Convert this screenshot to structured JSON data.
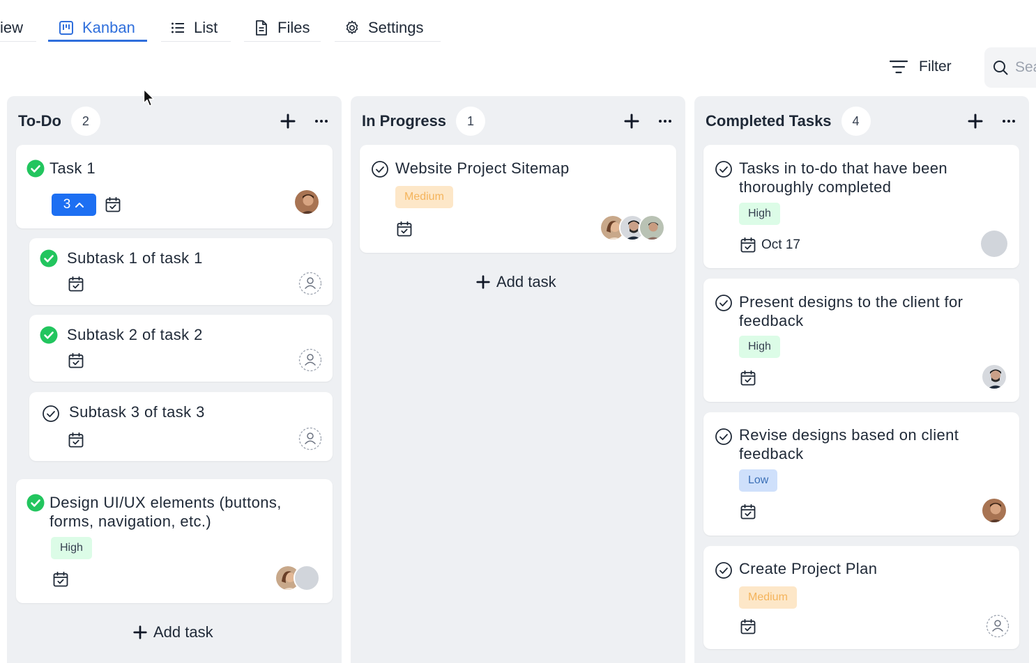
{
  "tabs": [
    {
      "label": "iew",
      "icon": "overview-icon"
    },
    {
      "label": "Kanban",
      "icon": "kanban-icon",
      "active": true
    },
    {
      "label": "List",
      "icon": "list-icon"
    },
    {
      "label": "Files",
      "icon": "file-icon"
    },
    {
      "label": "Settings",
      "icon": "gear-icon"
    }
  ],
  "toolbar": {
    "filter_label": "Filter",
    "search_placeholder": "Search"
  },
  "colors": {
    "accent": "#2f6fdc",
    "done_green": "#22c55e",
    "subtask_blue": "#1d6ff2",
    "column_bg": "#eef0f3"
  },
  "columns": [
    {
      "title": "To-Do",
      "count": "2",
      "add_task_label": "Add task",
      "cards": [
        {
          "title": "Task 1",
          "done": true,
          "subtask_count": "3",
          "assignee": "avatar"
        },
        {
          "title": "Subtask 1 of task 1",
          "done": true,
          "assignee": "unassigned-user-icon"
        },
        {
          "title": "Subtask 2 of task 2",
          "done": true,
          "assignee": "unassigned-user-icon"
        },
        {
          "title": "Subtask 3 of task 3",
          "done": false,
          "assignee": "unassigned-user-icon"
        },
        {
          "title": "Design UI/UX elements (buttons, forms, navigation, etc.)",
          "done": true,
          "priority": "High",
          "assignee": "avatar-group"
        }
      ]
    },
    {
      "title": "In Progress",
      "count": "1",
      "add_task_label": "Add task",
      "cards": [
        {
          "title": "Website Project Sitemap",
          "done": false,
          "priority": "Medium",
          "assignee": "avatar-group"
        }
      ]
    },
    {
      "title": "Completed Tasks",
      "count": "4",
      "cards": [
        {
          "title": "Tasks in to-do that have been thoroughly completed",
          "done": false,
          "priority": "High",
          "due": "Oct 17",
          "assignee": "avatar"
        },
        {
          "title": "Present designs to the client for feedback",
          "done": false,
          "priority": "High",
          "assignee": "avatar"
        },
        {
          "title": "Revise designs based on client feedback",
          "done": false,
          "priority": "Low",
          "assignee": "avatar"
        },
        {
          "title": "Create Project Plan",
          "done": false,
          "priority": "Medium",
          "assignee": "unassigned-user-icon"
        }
      ]
    }
  ]
}
